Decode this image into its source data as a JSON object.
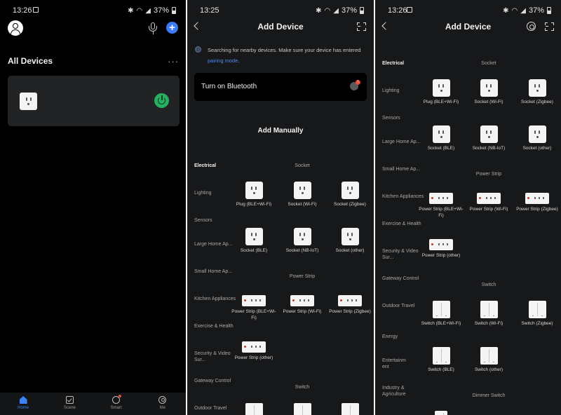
{
  "screen1": {
    "status": {
      "time": "13:26",
      "battery": "37%"
    },
    "section_title": "All Devices",
    "more": "···",
    "tabs": [
      {
        "label": "Home",
        "icon": "home-icon",
        "active": true
      },
      {
        "label": "Scene",
        "icon": "scene-icon",
        "active": false
      },
      {
        "label": "Smart",
        "icon": "smart-icon",
        "active": false
      },
      {
        "label": "Me",
        "icon": "me-icon",
        "active": false
      }
    ],
    "colors": {
      "accent": "#3b82f6",
      "power_on": "#27ae60"
    }
  },
  "screen2": {
    "status": {
      "time": "13:25",
      "battery": "37%"
    },
    "title": "Add Device",
    "searching_text": "Searching for nearby devices. Make sure your device has entered",
    "pairing_link": "pairing mode",
    "searching_end": ".",
    "bluetooth_label": "Turn on Bluetooth",
    "bluetooth_badge": "!",
    "add_manually": "Add Manually",
    "categories": [
      "Electrical",
      "Lighting",
      "Sensors",
      "Large Home Ap...",
      "Small Home Ap...",
      "Kitchen Appliances",
      "Exercise & Health",
      "Security & Video Sur...",
      "Gateway Control",
      "Outdoor Travel"
    ],
    "sections": {
      "socket": "Socket",
      "power_strip": "Power Strip",
      "switch": "Switch"
    },
    "socket_items": [
      "Plug (BLE+Wi-Fi)",
      "Socket (Wi-Fi)",
      "Socket (Zigbee)",
      "Socket (BLE)",
      "Socket (NB-IoT)",
      "Socket (other)"
    ],
    "strip_items": [
      "Power Strip (BLE+Wi-Fi)",
      "Power Strip (Wi-Fi)",
      "Power Strip (Zigbee)",
      "Power Strip (other)"
    ]
  },
  "screen3": {
    "status": {
      "time": "13:26",
      "battery": "37%"
    },
    "title": "Add Device",
    "categories": [
      "Electrical",
      "Lighting",
      "Sensors",
      "Large Home Ap...",
      "Small Home Ap...",
      "Kitchen Appliances",
      "Exercise & Health",
      "Security & Video Sur...",
      "Gateway Control",
      "Outdoor Travel",
      "Energy",
      "Entertainm ent",
      "Industry & Agriculture"
    ],
    "sections": {
      "socket": "Socket",
      "power_strip": "Power Strip",
      "switch": "Switch",
      "dimmer": "Dimmer Switch"
    },
    "socket_items": [
      "Plug (BLE+Wi-Fi)",
      "Socket (Wi-Fi)",
      "Socket (Zigbee)",
      "Socket (BLE)",
      "Socket (NB-IoT)",
      "Socket (other)"
    ],
    "strip_items": [
      "Power Strip (BLE+Wi-Fi)",
      "Power Strip (Wi-Fi)",
      "Power Strip (Zigbee)",
      "Power Strip (other)"
    ],
    "switch_items": [
      "Switch (BLE+Wi-Fi)",
      "Switch (Wi-Fi)",
      "Switch (Zigbee)",
      "Switch (BLE)",
      "Switch (other)"
    ]
  }
}
